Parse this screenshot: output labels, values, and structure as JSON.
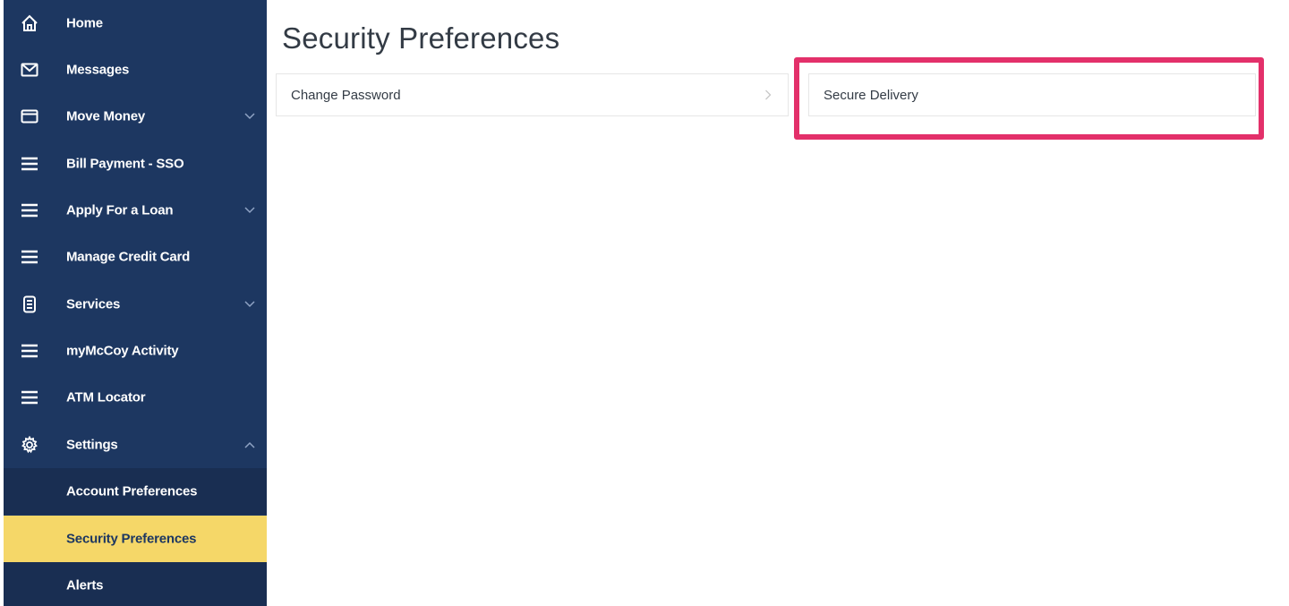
{
  "sidebar": {
    "items": [
      {
        "label": "Home",
        "icon": "home-icon"
      },
      {
        "label": "Messages",
        "icon": "envelope-icon"
      },
      {
        "label": "Move Money",
        "icon": "card-icon",
        "chevron": "down"
      },
      {
        "label": "Bill Payment - SSO",
        "icon": "menu-icon"
      },
      {
        "label": "Apply For a Loan",
        "icon": "menu-icon",
        "chevron": "down"
      },
      {
        "label": "Manage Credit Card",
        "icon": "menu-icon"
      },
      {
        "label": "Services",
        "icon": "phone-icon",
        "chevron": "down"
      },
      {
        "label": "myMcCoy Activity",
        "icon": "menu-icon"
      },
      {
        "label": "ATM Locator",
        "icon": "menu-icon"
      },
      {
        "label": "Settings",
        "icon": "gear-icon",
        "chevron": "up"
      }
    ],
    "settings_subitems": [
      {
        "label": "Account Preferences",
        "active": false
      },
      {
        "label": "Security Preferences",
        "active": true
      },
      {
        "label": "Alerts",
        "active": false
      }
    ]
  },
  "main": {
    "title": "Security Preferences",
    "tiles": [
      {
        "label": "Change Password"
      },
      {
        "label": "Secure Delivery"
      }
    ]
  },
  "colors": {
    "sidebar_bg": "#1d3761",
    "submenu_bg": "#192e52",
    "active_bg": "#f5d768",
    "highlight_border": "#e3306a"
  }
}
